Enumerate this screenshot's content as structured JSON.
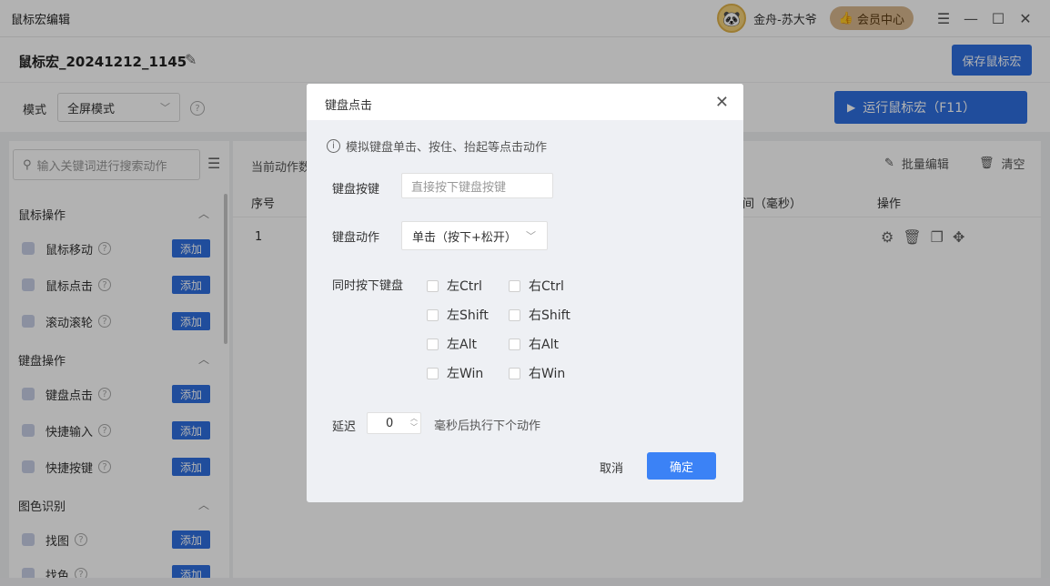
{
  "app": {
    "title": "鼠标宏编辑"
  },
  "user": {
    "name": "金舟-苏大爷",
    "member_label": "会员中心"
  },
  "colors": {
    "primary": "#2f6fe0",
    "member_bg": "#d9b88f"
  },
  "doc": {
    "title": "鼠标宏_20241212_1145",
    "save_label": "保存鼠标宏"
  },
  "mode": {
    "label": "模式",
    "value": "全屏模式",
    "run_label": "运行鼠标宏（F11）"
  },
  "sidebar": {
    "search_placeholder": "输入关键词进行搜索动作",
    "add_label": "添加",
    "categories": [
      {
        "label": "鼠标操作",
        "items": [
          "鼠标移动",
          "鼠标点击",
          "滚动滚轮"
        ]
      },
      {
        "label": "键盘操作",
        "items": [
          "键盘点击",
          "快捷输入",
          "快捷按键"
        ]
      },
      {
        "label": "图色识别",
        "items": [
          "找图",
          "找色"
        ]
      }
    ]
  },
  "content": {
    "count_label": "当前动作数",
    "batch_edit": "批量编辑",
    "clear": "清空",
    "columns": {
      "index": "序号",
      "delay": "间（毫秒）",
      "actions": "操作"
    },
    "rows": [
      {
        "index": "1"
      }
    ]
  },
  "dialog": {
    "title": "键盘点击",
    "info": "模拟键盘单击、按住、抬起等点击动作",
    "key_label": "键盘按键",
    "key_placeholder": "直接按下键盘按键",
    "action_label": "键盘动作",
    "action_value": "单击（按下+松开）",
    "modifiers_label": "同时按下键盘",
    "modifiers": [
      "左Ctrl",
      "右Ctrl",
      "左Shift",
      "右Shift",
      "左Alt",
      "右Alt",
      "左Win",
      "右Win"
    ],
    "delay_label": "延迟",
    "delay_value": "0",
    "delay_suffix": "毫秒后执行下个动作",
    "cancel": "取消",
    "ok": "确定"
  }
}
